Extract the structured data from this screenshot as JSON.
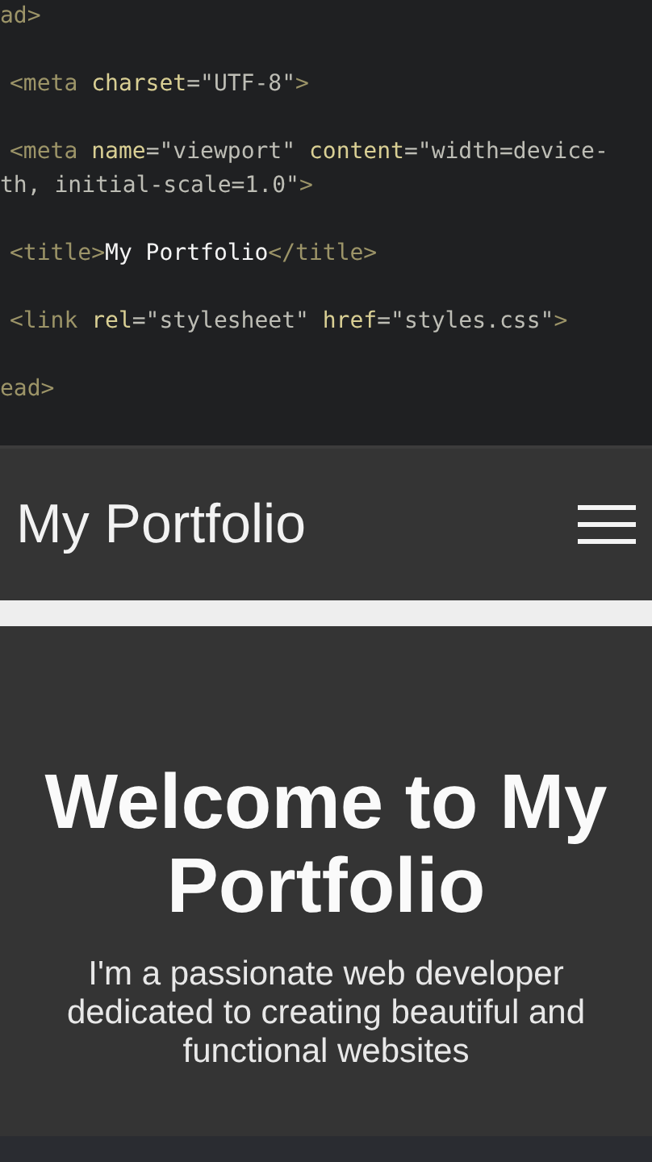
{
  "code_editor": {
    "lines": [
      {
        "indent": false,
        "gap": false,
        "tokens": [
          {
            "kind": "tag",
            "text": "ad>"
          }
        ]
      },
      {
        "indent": true,
        "gap": true,
        "tokens": [
          {
            "kind": "tag",
            "text": "<meta"
          },
          {
            "kind": "attr",
            "text": " charset"
          },
          {
            "kind": "str",
            "text": "=\"UTF-8\""
          },
          {
            "kind": "tag",
            "text": ">"
          }
        ]
      },
      {
        "indent": true,
        "gap": true,
        "tokens": [
          {
            "kind": "tag",
            "text": "<meta"
          },
          {
            "kind": "attr",
            "text": " name"
          },
          {
            "kind": "str",
            "text": "=\"viewport\""
          },
          {
            "kind": "attr",
            "text": " content"
          },
          {
            "kind": "str",
            "text": "=\"width=device-"
          }
        ]
      },
      {
        "indent": false,
        "gap": false,
        "tokens": [
          {
            "kind": "str",
            "text": "th, initial-scale=1.0\""
          },
          {
            "kind": "tag",
            "text": ">"
          }
        ]
      },
      {
        "indent": true,
        "gap": true,
        "tokens": [
          {
            "kind": "tag",
            "text": "<title>"
          },
          {
            "kind": "text",
            "text": "My Portfolio"
          },
          {
            "kind": "tag",
            "text": "</title>"
          }
        ]
      },
      {
        "indent": true,
        "gap": true,
        "tokens": [
          {
            "kind": "tag",
            "text": "<link"
          },
          {
            "kind": "attr",
            "text": " rel"
          },
          {
            "kind": "str",
            "text": "=\"stylesheet\""
          },
          {
            "kind": "attr",
            "text": " href"
          },
          {
            "kind": "str",
            "text": "=\"styles.css\""
          },
          {
            "kind": "tag",
            "text": ">"
          }
        ]
      },
      {
        "indent": false,
        "gap": true,
        "tokens": [
          {
            "kind": "tag",
            "text": "ead>"
          }
        ]
      }
    ]
  },
  "navbar": {
    "brand": "My Portfolio"
  },
  "hero": {
    "heading": "Welcome to My Portfolio",
    "text": "I'm a passionate web developer dedicated to creating beautiful and functional websites"
  }
}
